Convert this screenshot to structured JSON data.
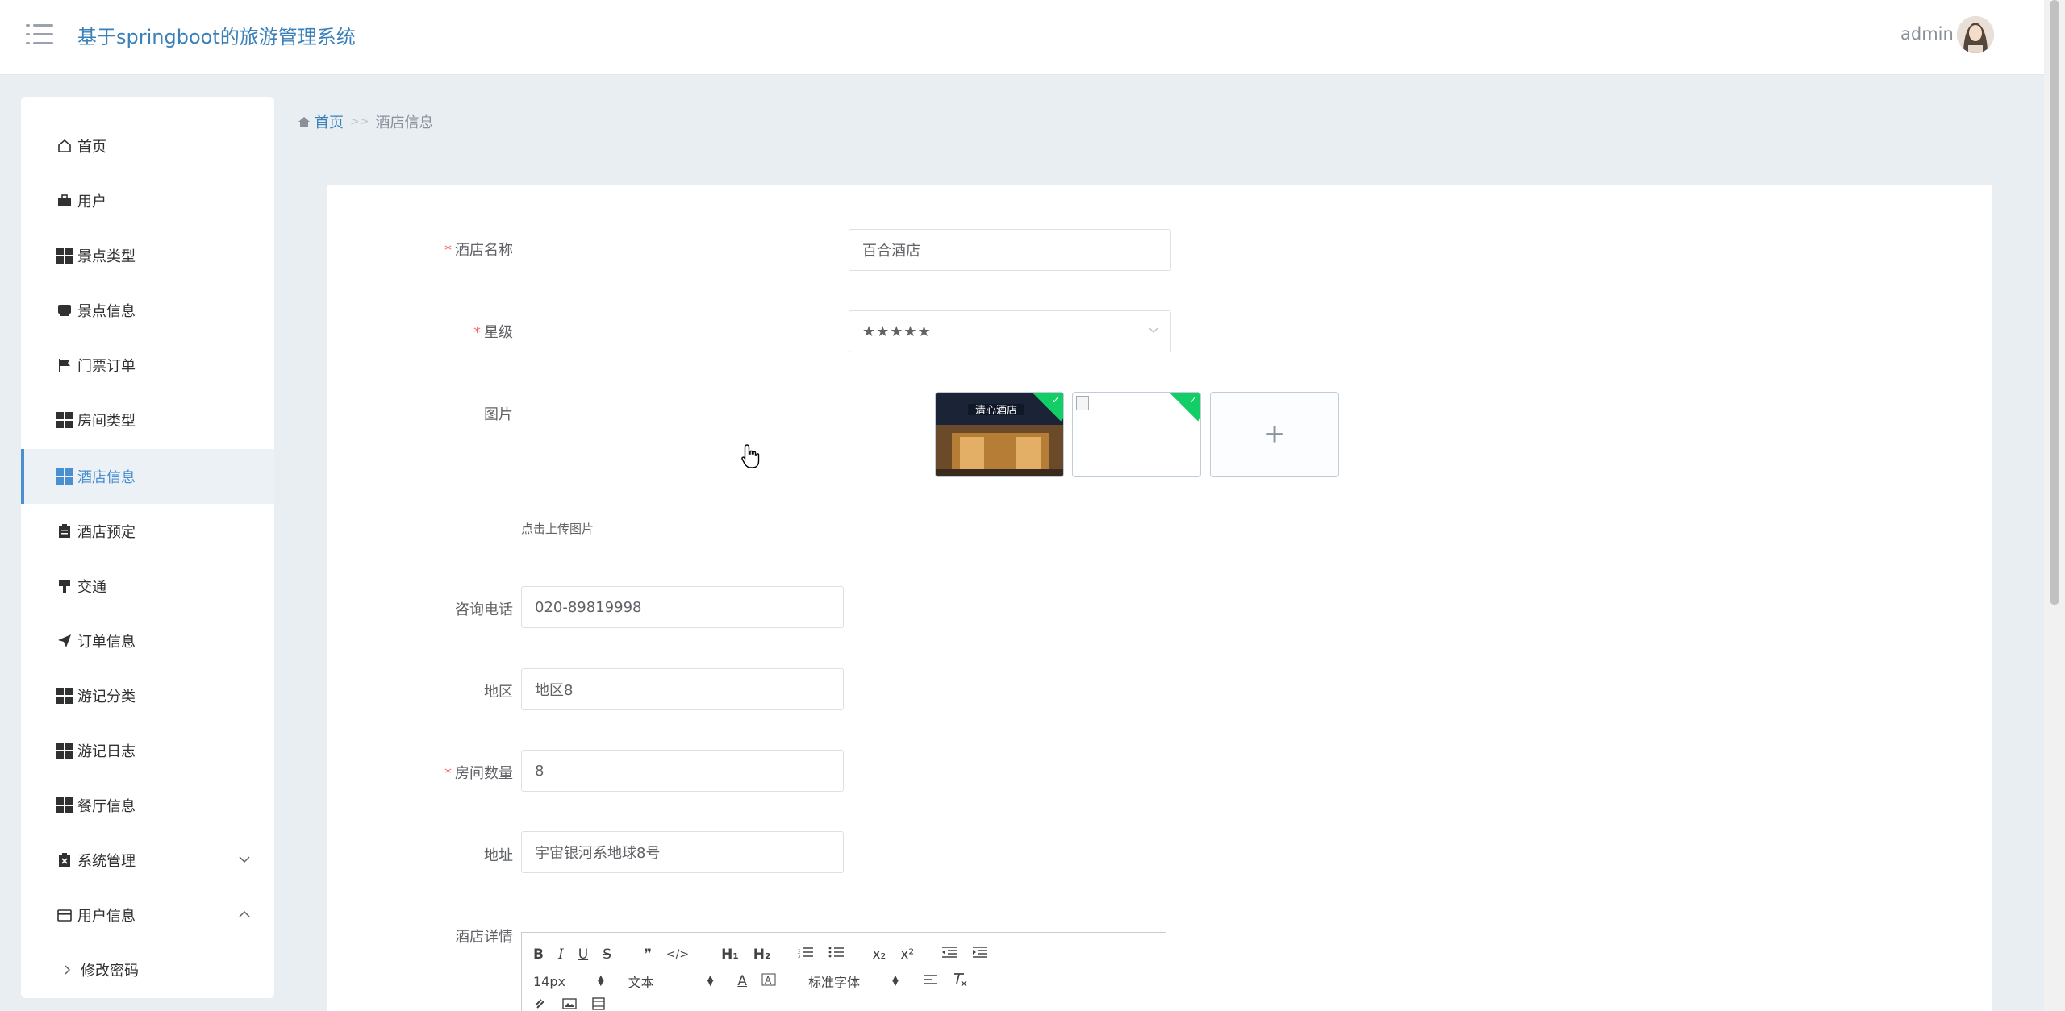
{
  "header": {
    "title": "基于springboot的旅游管理系统",
    "user": "admin"
  },
  "sidebar": {
    "items": [
      {
        "label": "首页",
        "icon": "home-icon"
      },
      {
        "label": "用户",
        "icon": "briefcase-icon"
      },
      {
        "label": "景点类型",
        "icon": "grid-icon"
      },
      {
        "label": "景点信息",
        "icon": "tray-icon"
      },
      {
        "label": "门票订单",
        "icon": "flag-icon"
      },
      {
        "label": "房间类型",
        "icon": "grid-icon"
      },
      {
        "label": "酒店信息",
        "icon": "grid-icon",
        "active": true
      },
      {
        "label": "酒店预定",
        "icon": "clipboard-icon"
      },
      {
        "label": "交通",
        "icon": "brush-icon"
      },
      {
        "label": "订单信息",
        "icon": "send-icon"
      },
      {
        "label": "游记分类",
        "icon": "grid-icon"
      },
      {
        "label": "游记日志",
        "icon": "grid-icon"
      },
      {
        "label": "餐厅信息",
        "icon": "grid-icon"
      },
      {
        "label": "系统管理",
        "icon": "clipboard-x-icon",
        "chevron": "down"
      },
      {
        "label": "用户信息",
        "icon": "wallet-icon",
        "chevron": "up"
      },
      {
        "label": "修改密码",
        "icon": "chevron-right-icon",
        "sub": true
      }
    ]
  },
  "breadcrumb": {
    "home": "首页",
    "separator": ">>",
    "current": "酒店信息"
  },
  "form": {
    "hotel_name": {
      "label": "酒店名称",
      "value": "百合酒店",
      "required": true
    },
    "star": {
      "label": "星级",
      "value": "★★★★★",
      "required": true
    },
    "image": {
      "label": "图片",
      "tip": "点击上传图片",
      "upload_symbol": "+"
    },
    "phone": {
      "label": "咨询电话",
      "value": "020-89819998"
    },
    "region": {
      "label": "地区",
      "value": "地区8"
    },
    "rooms": {
      "label": "房间数量",
      "value": "8",
      "required": true
    },
    "address": {
      "label": "地址",
      "value": "宇宙银河系地球8号"
    },
    "detail": {
      "label": "酒店详情"
    }
  },
  "editor": {
    "font_size": "14px",
    "block": "文本",
    "font": "标准字体",
    "buttons_row1": [
      "B",
      "I",
      "U",
      "S",
      "❞",
      "</>",
      "H₁",
      "H₂",
      "ol",
      "ul",
      "x₂",
      "x²",
      "outdent",
      "indent"
    ]
  },
  "colors": {
    "accent": "#4a8fd0",
    "title": "#3a80b9",
    "required": "#f56c6c",
    "upload_success": "#13ce66"
  }
}
